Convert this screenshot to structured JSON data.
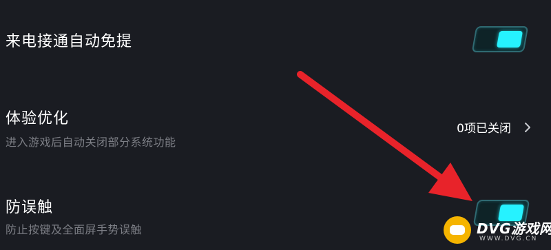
{
  "settings": {
    "auto_answer": {
      "title": "来电接通自动免提",
      "toggle_on": true
    },
    "optimize": {
      "title": "体验优化",
      "description": "进入游戏后自动关闭部分系统功能",
      "value": "0项已关闭"
    },
    "anti_mistouch": {
      "title": "防误触",
      "description": "防止按键及全面屏手势误触",
      "toggle_on": true
    }
  },
  "annotation": {
    "arrow_color": "#e8232a"
  },
  "watermark": {
    "brand": "DVG游戏网",
    "url": "WWW.DVG.CN"
  },
  "colors": {
    "background": "#1a1c22",
    "toggle_accent": "#26f2ff",
    "text_primary": "#ffffff",
    "text_secondary": "#7c7e85"
  }
}
